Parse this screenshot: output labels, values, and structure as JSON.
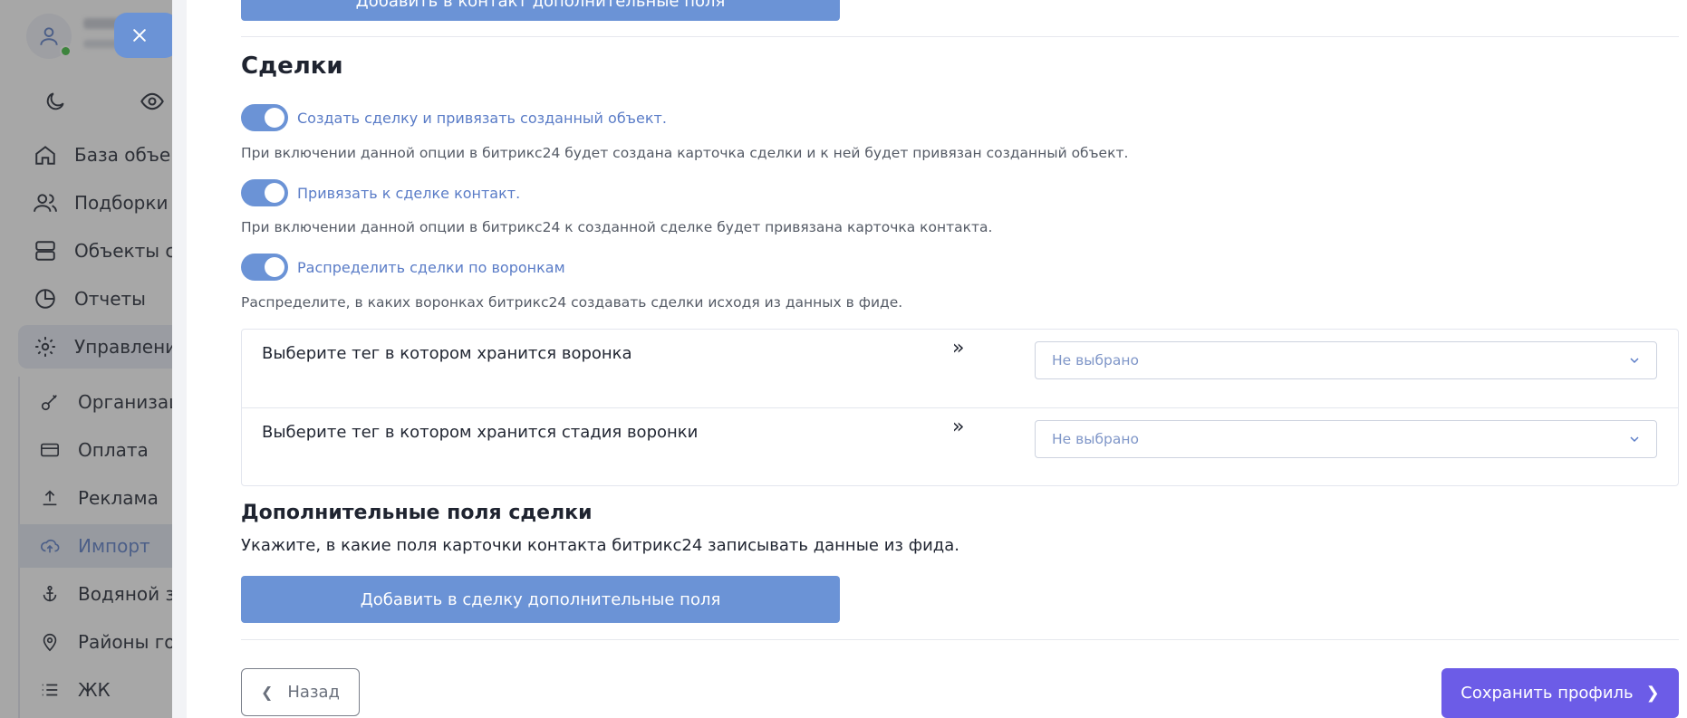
{
  "sidebar": {
    "nav": [
      {
        "label": "База объек",
        "icon": "home-icon"
      },
      {
        "label": "Подборки",
        "icon": "users-icon"
      },
      {
        "label": "Объекты с",
        "icon": "server-icon"
      },
      {
        "label": "Отчеты",
        "icon": "pie-chart-icon"
      },
      {
        "label": "Управлени",
        "icon": "gear-icon"
      }
    ],
    "submenu": [
      {
        "label": "Организац",
        "icon": "key-icon"
      },
      {
        "label": "Оплата",
        "icon": "card-icon"
      },
      {
        "label": "Реклама",
        "icon": "upload-icon"
      },
      {
        "label": "Импорт",
        "icon": "cloud-upload-icon"
      },
      {
        "label": "Водяной з",
        "icon": "anchor-icon"
      },
      {
        "label": "Районы го",
        "icon": "map-pin-icon"
      },
      {
        "label": "ЖК",
        "icon": "list-icon"
      }
    ]
  },
  "drawer": {
    "prev_button": "Добавить в контакт дополнительные поля",
    "section_title": "Сделки",
    "toggles": [
      {
        "label": "Создать сделку и привязать созданный объект.",
        "on": true,
        "help": "При включении данной опции в битрикс24 будет создана карточка сделки и к ней будет привязан созданный объект."
      },
      {
        "label": "Привязать к сделке контакт.",
        "on": true,
        "help": "При включении данной опции в битрикс24 к созданной сделке будет привязана карточка контакта."
      },
      {
        "label": "Распределить сделки по воронкам",
        "on": true,
        "help": "Распределите, в каких воронках битрикс24 создавать сделки исходя из данных в фиде."
      }
    ],
    "mapping": [
      {
        "label": "Выберите тег в котором хранится воронка",
        "arrow": "»",
        "value": "Не выбрано"
      },
      {
        "label": "Выберите тег в котором хранится стадия воронки",
        "arrow": "»",
        "value": "Не выбрано"
      }
    ],
    "extra_title": "Дополнительные поля сделки",
    "extra_desc": "Укажите, в какие поля карточки контакта битрикс24 записывать данные из фида.",
    "add_button": "Добавить в сделку дополнительные поля",
    "back_button": "Назад",
    "save_button": "Сохранить профиль"
  },
  "colors": {
    "accent": "#6b93d6",
    "primary": "#6c5ce7",
    "overlay": "#3c3c3c"
  }
}
